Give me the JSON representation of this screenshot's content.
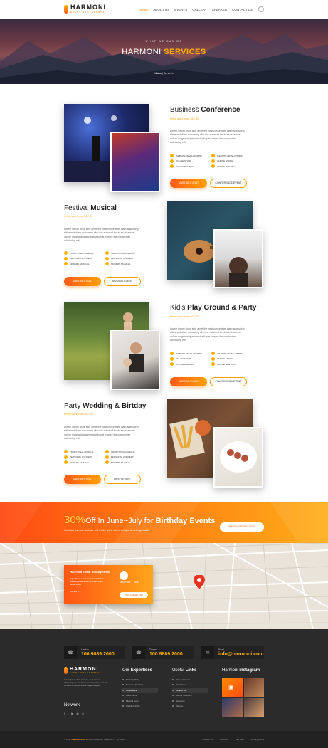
{
  "brand": {
    "name": "HARMONI",
    "tagline": "EVENT MANAGEMENT"
  },
  "nav": {
    "items": [
      "HOME",
      "ABOUT US",
      "EVENTS",
      "GALLERY",
      "SPEAKER",
      "CONTACT US"
    ],
    "active": "HOME"
  },
  "hero": {
    "kicker": "WHAT WE CAN DO",
    "title_plain": "HARMONI",
    "title_bold": "SERVICES",
    "crumb_home": "Home",
    "crumb_sep": "|",
    "crumb_current": "Services"
  },
  "services": [
    {
      "title_light": "Business",
      "title_bold": "Conference",
      "price": "Price start from $12.00",
      "desc": "Lorem ipsum dolor sitte amet the best consectuer diam adipiscing elites sed diam nonummy nibh the euismod tincidunt ut laoreet dolore magna aliquam erat volutpat Integre the consectuer adipiscing elit",
      "features": [
        "WEBSITE DEVELOPMENT",
        "WEBSITE DEVELOPMENT",
        "ONLINE STORE",
        "ONLINE STORE",
        "OFFICE MEETING",
        "OFFICE MEETING"
      ],
      "btn_primary": "MAKE AN EVENT",
      "btn_secondary": "CONFERENCE EVENT"
    },
    {
      "title_light": "Festival",
      "title_bold": "Musical",
      "price": "Price start from $12.00",
      "desc": "Lorem ipsum dolor sitte amet the best consectuer diam adipiscing elites sed diam nonummy nibh the euismod tincidunt ut laoreet dolore magna aliquam erat volutpat Integre the consectuer adipiscing elit",
      "features": [
        "TRADITIONAL MUSICAL",
        "TRADITIONAL MUSICAL",
        "PERSONAL CONCERT",
        "PERSONAL CONCERT",
        "MODERN MUSICAL",
        "MODERN MUSICAL"
      ],
      "btn_primary": "MAKE AN EVENT",
      "btn_secondary": "MUSICAL EVENT"
    },
    {
      "title_light": "Kid's",
      "title_bold": "Play Ground & Party",
      "price": "Price start from $12.00",
      "desc": "Lorem ipsum dolor sitte amet the best consectuer diam adipiscing elites sed diam nonummy nibh the euismod tincidunt ut laoreet dolore magna aliquam erat volutpat Integre the consectuer adipiscing elit",
      "features": [
        "WEBSITE DEVELOPMENT",
        "WEBSITE DEVELOPMENT",
        "ONLINE STORE",
        "ONLINE STORE",
        "OFFICE MEETING",
        "OFFICE MEETING"
      ],
      "btn_primary": "MAKE AN EVENT",
      "btn_secondary": "PLAYGROUND EVENT"
    },
    {
      "title_light": "Party",
      "title_bold": "Wedding & Birtday",
      "price": "Price start from $12.00",
      "desc": "Lorem ipsum dolor sitte amet the best consectuer diam adipiscing elites sed diam nonummy nibh the euismod tincidunt ut laoreet dolore magna aliquam erat volutpat Integre the consectuer adipiscing elit",
      "features": [
        "TRADITIONAL MUSICAL",
        "TRADITIONAL MUSICAL",
        "PERSONAL CONCERT",
        "PERSONAL CONCERT",
        "MODERN MUSICAL",
        "MODERN MUSICAL"
      ],
      "btn_primary": "MAKE AN EVENT",
      "btn_secondary": "PARTY EVENT"
    }
  ],
  "promo": {
    "percent": "30%",
    "text_a": "Off In June~July for",
    "text_bold": "Birthday Events",
    "sub": "Contact us now and we will make your event unique & unforgettable",
    "button": "MAKE AN EVENT NOW"
  },
  "map_card": {
    "title": "Harmoni Event management",
    "address": "Jagan Street, 123 Avenue New York Dela adipiscing elites nonummy tincidunt nibh Sebian Arena",
    "rating": "4.6 ★★★★",
    "directions": "DIRECTIONS",
    "save": "SAVE",
    "view": "VIEW LARGER MAP"
  },
  "contacts": [
    {
      "label": "London",
      "value": "100.9889.2000",
      "icon": "phone-icon"
    },
    {
      "label": "Tronas",
      "value": "100.9889.2000",
      "icon": "phone-icon"
    },
    {
      "label": "Email",
      "value": "info@harmoni.com",
      "icon": "mail-icon"
    }
  ],
  "footer": {
    "about": "Lorem ipsum dolor sit amet, consectetur adipiscing elit, sed diam nonummy nibh euismod tincidunt ut laoreet dolore magna aliquam",
    "network_title": "Network",
    "expertise_title_light": "Our",
    "expertise_title_bold": "Expertises",
    "expertise": [
      "Birthday Party",
      "Business Meeting",
      "Conference",
      "Food Event",
      "Musical Event",
      "Wedding Party"
    ],
    "links_title_light": "Useful",
    "links_title_bold": "Links",
    "links": [
      "About Harmoni",
      "Disclaimer",
      "Contact us",
      "Events Schedule",
      "Sponsors",
      "Venues"
    ],
    "insta_title_light": "Harmoni",
    "insta_title_bold": "Instagram",
    "copyright_pre": "© 2018",
    "copyright_brand": "Harmoni.com",
    "copyright_post": "all rights reserved, made with ❤ by Jacob",
    "bottom_links": [
      "Contact us",
      "About us",
      "Site map",
      "Privacy policy"
    ]
  },
  "colors": {
    "accent": "#ffa200",
    "accent_deep": "#ff5a1a",
    "dark": "#2b2b2b"
  }
}
